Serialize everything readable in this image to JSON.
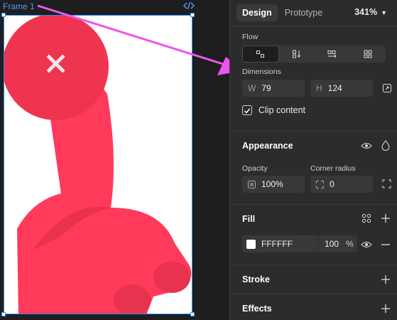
{
  "canvas": {
    "frame_label": "Frame 1"
  },
  "tabs": {
    "design": "Design",
    "prototype": "Prototype",
    "zoom": "341%"
  },
  "flow": {
    "label": "Flow"
  },
  "dimensions": {
    "label": "Dimensions",
    "w_prefix": "W",
    "w_value": "79",
    "h_prefix": "H",
    "h_value": "124",
    "clip_label": "Clip content",
    "clip_checked": true
  },
  "appearance": {
    "title": "Appearance",
    "opacity_label": "Opacity",
    "opacity_value": "100%",
    "radius_label": "Corner radius",
    "radius_value": "0"
  },
  "fill": {
    "title": "Fill",
    "color_hex": "FFFFFF",
    "opacity": "100",
    "unit": "%"
  },
  "stroke": {
    "title": "Stroke"
  },
  "effects": {
    "title": "Effects"
  },
  "colors": {
    "accent": "#2b8cff",
    "arrow": "#ee55ee",
    "art": "#ff3a5a"
  }
}
